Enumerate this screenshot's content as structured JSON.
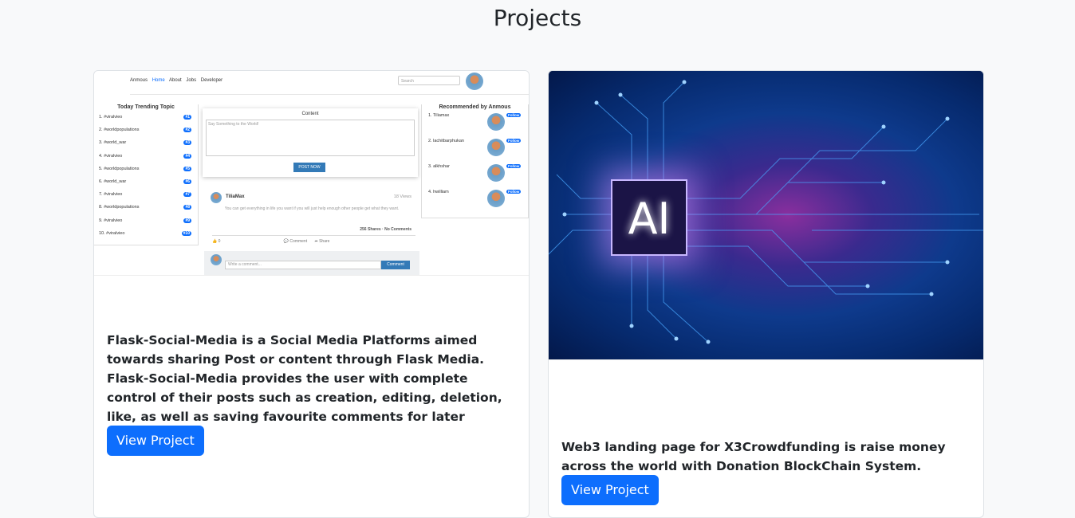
{
  "section": {
    "title": "Projects"
  },
  "projects": [
    {
      "description": "Flask-Social-Media is a Social Media Platforms aimed towards sharing Post or content through Flask Media. Flask-Social-Media provides the user with complete control of their posts such as creation, editing, deletion, like, as well as saving favourite comments for later reference.",
      "button_label": "View Project",
      "screenshot": {
        "nav": [
          "Anmous",
          "Home",
          "About",
          "Jobs",
          "Developer"
        ],
        "search_placeholder": "Search",
        "trending_title": "Today Trending Topic",
        "trending": [
          {
            "label": "1. #viralvieo",
            "badge": "#1"
          },
          {
            "label": "2. #worldpopulations",
            "badge": "#2"
          },
          {
            "label": "3. #world_war",
            "badge": "#3"
          },
          {
            "label": "4. #viralvieo",
            "badge": "#4"
          },
          {
            "label": "5. #worldpopulations",
            "badge": "#5"
          },
          {
            "label": "6. #world_war",
            "badge": "#6"
          },
          {
            "label": "7. #viralvieo",
            "badge": "#7"
          },
          {
            "label": "8. #worldpopulations",
            "badge": "#8"
          },
          {
            "label": "9. #viralvieo",
            "badge": "#9"
          },
          {
            "label": "10. #viralvieo",
            "badge": "#10"
          }
        ],
        "content_title": "Content",
        "content_placeholder": "Say Something to the World!",
        "post_button": "POST NOW",
        "recommended_title": "Recommended by Anmous",
        "recommended": [
          {
            "label": "1. Tiliamax",
            "badge": "Follow"
          },
          {
            "label": "2. lachitbarphukan",
            "badge": "Follow"
          },
          {
            "label": "3. alkhshar",
            "badge": "Follow"
          },
          {
            "label": "4. hwilliam",
            "badge": "Follow"
          }
        ],
        "post_user": "TiliaMax",
        "post_views": "18 Views",
        "post_text": "You can get everything in life you want if you will just help enough other people get what they want.",
        "post_stats": "256 Shares · No Comments",
        "post_likes": "0",
        "post_comment": "Comment",
        "post_share": "Share",
        "comment_placeholder": "Write a comment...",
        "comment_button": "Comment"
      }
    },
    {
      "description": "Web3 landing page for X3Crowdfunding is raise money across the world with Donation BlockChain System.",
      "button_label": "View Project",
      "image_text": "AI"
    }
  ],
  "colors": {
    "primary": "#0d6efd",
    "background": "#f8f9fa"
  }
}
